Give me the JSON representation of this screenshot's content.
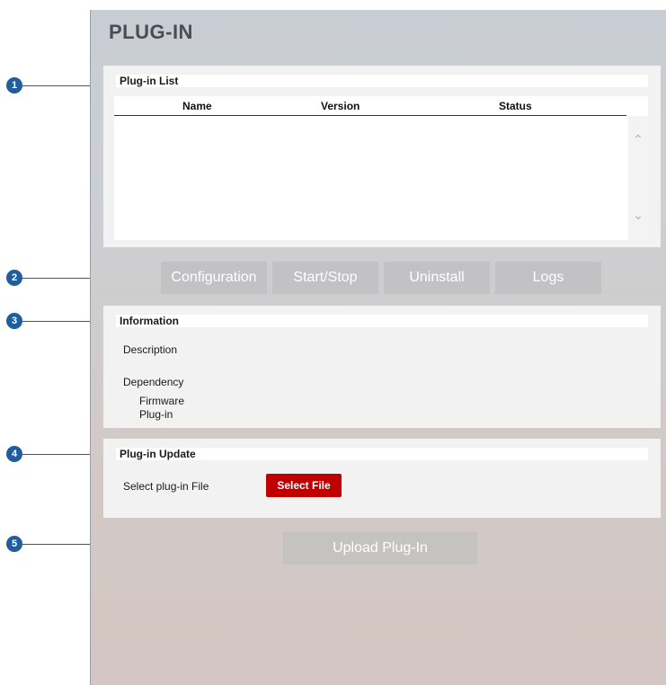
{
  "page": {
    "title": "PLUG-IN"
  },
  "plugin_list": {
    "heading": "Plug-in List",
    "columns": [
      "Name",
      "Version",
      "Status"
    ],
    "rows": []
  },
  "actions": {
    "configuration": "Configuration",
    "start_stop": "Start/Stop",
    "uninstall": "Uninstall",
    "logs": "Logs"
  },
  "information": {
    "heading": "Information",
    "description_label": "Description",
    "dependency_label": "Dependency",
    "firmware_label": "Firmware",
    "plugin_label": "Plug-in"
  },
  "update": {
    "heading": "Plug-in Update",
    "select_label": "Select plug-in File",
    "select_button": "Select File",
    "upload_button": "Upload Plug-In"
  },
  "callouts": [
    "1",
    "2",
    "3",
    "4",
    "5"
  ],
  "colors": {
    "accent_blue": "#1f5d9e",
    "select_red": "#c00000",
    "button_gray": "#c2c2c4"
  }
}
